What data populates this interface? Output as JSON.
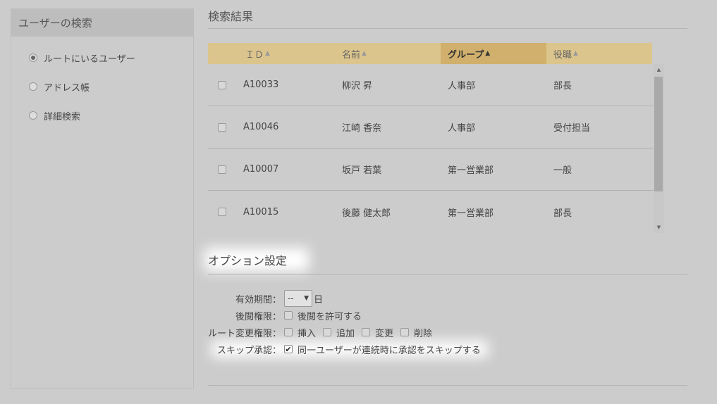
{
  "sidebar": {
    "title": "ユーザーの検索",
    "options": [
      {
        "label": "ルートにいるユーザー",
        "selected": true
      },
      {
        "label": "アドレス帳",
        "selected": false
      },
      {
        "label": "詳細検索",
        "selected": false
      }
    ]
  },
  "results": {
    "title": "検索結果",
    "columns": [
      "ＩＤ",
      "名前",
      "グループ",
      "役職"
    ],
    "sorted_column": "グループ",
    "sort_up": "▲",
    "sort_down": "▼",
    "rows": [
      {
        "id": "A10033",
        "name": "柳沢 昇",
        "group": "人事部",
        "role": "部長"
      },
      {
        "id": "A10046",
        "name": "江崎 香奈",
        "group": "人事部",
        "role": "受付担当"
      },
      {
        "id": "A10007",
        "name": "坂戸 若葉",
        "group": "第一営業部",
        "role": "一般"
      },
      {
        "id": "A10015",
        "name": "後藤 健太郎",
        "group": "第一営業部",
        "role": "部長"
      }
    ]
  },
  "options": {
    "title": "オプション設定",
    "validity_label": "有効期間：",
    "validity_value": "--",
    "validity_unit": "日",
    "read_label": "後閲権限：",
    "read_option": "後閲を許可する",
    "route_label": "ルート変更権限：",
    "route_options": [
      "挿入",
      "追加",
      "変更",
      "削除"
    ],
    "skip_label": "スキップ承認：",
    "skip_option": "同一ユーザーが連続時に承認をスキップする",
    "skip_checked": true,
    "check_mark": "✔",
    "dropdown_arrow": "▼"
  },
  "colors": {
    "table_header": "#dcc58c",
    "table_header_active": "#d0b06c",
    "background": "#cccccc"
  }
}
